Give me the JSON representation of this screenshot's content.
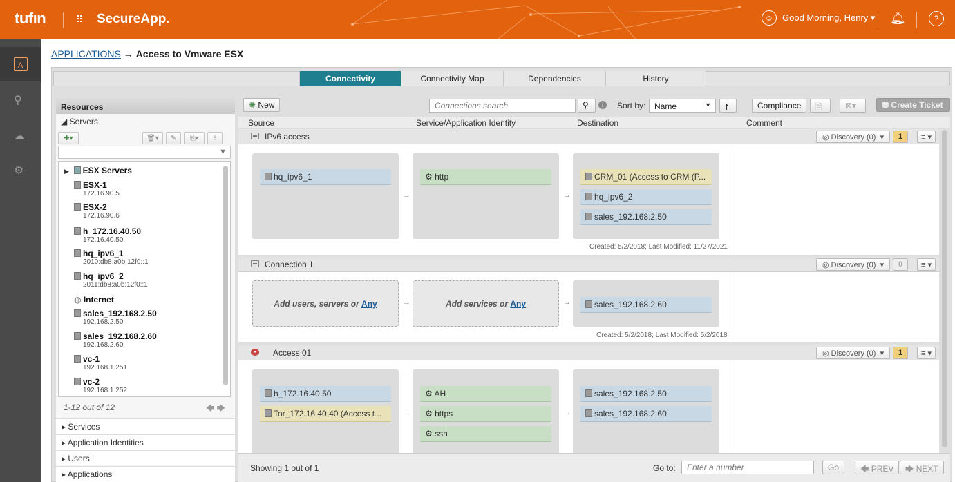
{
  "header": {
    "logo": "tufın",
    "app_name": "SecureApp.",
    "greeting": "Good Morning, Henry ▾",
    "help": "?"
  },
  "breadcrumb": {
    "root": "APPLICATIONS",
    "arrow": "→",
    "current": "Access to Vmware ESX"
  },
  "tabs": [
    "Connectivity",
    "Connectivity Map",
    "Dependencies",
    "History"
  ],
  "resources": {
    "title": "Resources",
    "servers_label": "◢ Servers",
    "tree": [
      {
        "name": "ESX Servers",
        "ip": ""
      },
      {
        "name": "ESX-1",
        "ip": "172.16.90.5"
      },
      {
        "name": "ESX-2",
        "ip": "172.16.90.6"
      },
      {
        "name": "h_172.16.40.50",
        "ip": "172.16.40.50"
      },
      {
        "name": "hq_ipv6_1",
        "ip": "2010:db8:a0b:12f0::1"
      },
      {
        "name": "hq_ipv6_2",
        "ip": "2011:db8:a0b:12f0::1"
      },
      {
        "name": "Internet",
        "ip": ""
      },
      {
        "name": "sales_192.168.2.50",
        "ip": "192.168.2.50"
      },
      {
        "name": "sales_192.168.2.60",
        "ip": "192.168.2.60"
      },
      {
        "name": "vc-1",
        "ip": "192.168.1.251"
      },
      {
        "name": "vc-2",
        "ip": "192.168.1.252"
      }
    ],
    "pager": "1-12 out of 12",
    "sections": [
      "Services",
      "Application Identities",
      "Users",
      "Applications"
    ]
  },
  "toolbar": {
    "new": "New",
    "search_placeholder": "Connections search",
    "sort_label": "Sort by:",
    "sort_value": "Name",
    "compliance": "Compliance",
    "create_ticket": "Create Ticket"
  },
  "columns": [
    "Source",
    "Service/Application Identity",
    "Destination",
    "Comment"
  ],
  "connections": [
    {
      "name": "IPv6 access",
      "discovery": "Discovery (0)",
      "flag": "1",
      "sources": [
        "hq_ipv6_1"
      ],
      "services": [
        "http"
      ],
      "destinations": [
        "CRM_01 (Access to CRM (P...",
        "hq_ipv6_2",
        "sales_192.168.2.50"
      ],
      "created": "Created: 5/2/2018; Last Modified: 11/27/2021"
    },
    {
      "name": "Connection 1",
      "discovery": "Discovery (0)",
      "flag": "0",
      "add_sources": "Add users, servers or ",
      "add_services": "Add services or ",
      "any": "Any",
      "destinations": [
        "sales_192.168.2.60"
      ],
      "created": "Created: 5/2/2018; Last Modified: 5/2/2018"
    },
    {
      "name": "Access 01",
      "discovery": "Discovery (0)",
      "flag": "1",
      "sources": [
        "h_172.16.40.50",
        "Tor_172.16.40.40 (Access t..."
      ],
      "services": [
        "AH",
        "https",
        "ssh"
      ],
      "destinations": [
        "sales_192.168.2.50",
        "sales_192.168.2.60"
      ]
    }
  ],
  "footer": {
    "showing": "Showing 1 out of 1",
    "goto": "Go to:",
    "goto_placeholder": "Enter a number",
    "go": "Go",
    "prev": "PREV",
    "next": "NEXT"
  }
}
